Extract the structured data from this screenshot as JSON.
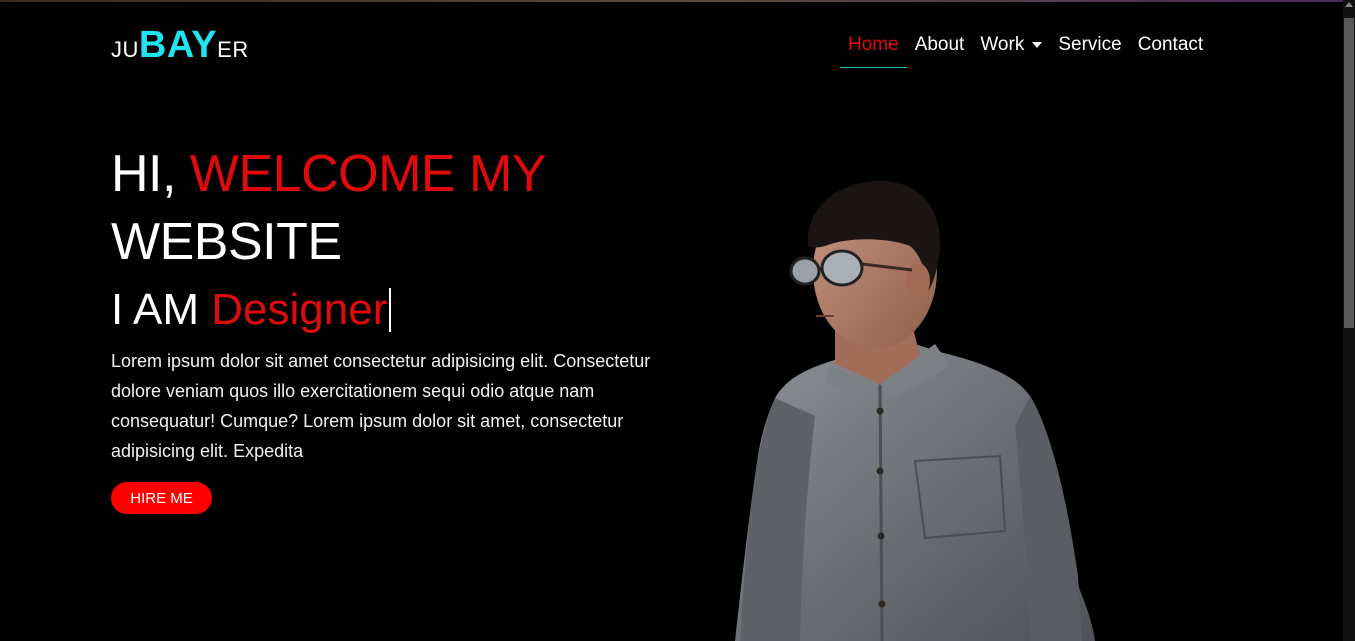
{
  "brand": {
    "prefix": "JU",
    "highlight": "BAY",
    "suffix": "ER"
  },
  "nav": [
    {
      "label": "Home",
      "active": true
    },
    {
      "label": "About"
    },
    {
      "label": "Work",
      "dropdown": true
    },
    {
      "label": "Service"
    },
    {
      "label": "Contact"
    }
  ],
  "hero": {
    "greeting": "HI,",
    "greeting_accent": "WELCOME MY",
    "greeting_end": "WEBSITE",
    "role_prefix": "I AM",
    "role": "Designer",
    "description": "Lorem ipsum dolor sit amet consectetur adipisicing elit. Consectetur dolore veniam quos illo exercitationem sequi odio atque nam consequatur! Cumque? Lorem ipsum dolor sit amet, consectetur adipisicing elit. Expedita",
    "cta": "HIRE ME"
  },
  "colors": {
    "accent": "#e10a0a",
    "brand": "#1fe3ee",
    "background": "#000000",
    "button": "#ff0000"
  },
  "icons": {
    "dropdown": "caret-down-icon"
  }
}
